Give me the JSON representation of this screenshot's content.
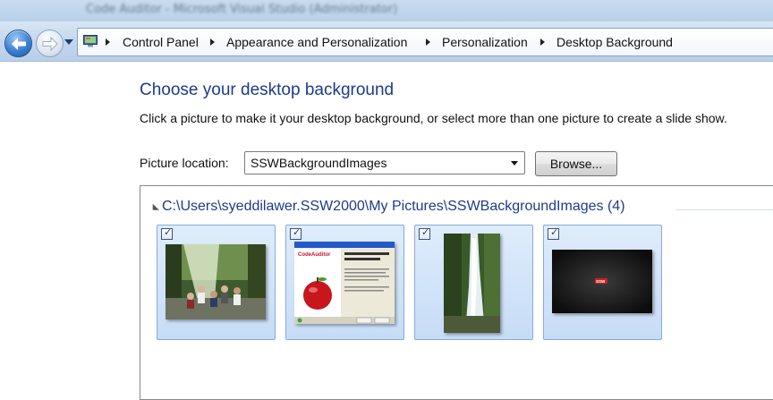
{
  "window": {
    "title": "Code Auditor - Microsoft Visual Studio (Administrator)"
  },
  "nav": {
    "breadcrumbs": [
      "Control Panel",
      "Appearance and Personalization",
      "Personalization",
      "Desktop Background"
    ]
  },
  "content": {
    "title": "Choose your desktop background",
    "description": "Click a picture to make it your desktop background, or select more than one picture to create a slide show.",
    "location_label": "Picture location:",
    "location_value": "SSWBackgroundImages",
    "browse_label": "Browse..."
  },
  "group": {
    "header": "C:\\Users\\syeddilawer.SSW2000\\My Pictures\\SSWBackgroundImages (4)"
  },
  "thumbnails": [
    {
      "name": "forest-group-photo",
      "checked": true
    },
    {
      "name": "code-auditor-welcome-screen",
      "checked": true,
      "window_title": "Welcome to SSW Code Auditor",
      "logo_text": "CodeAuditor"
    },
    {
      "name": "waterfall",
      "checked": true
    },
    {
      "name": "ssw-dark-wallpaper",
      "checked": true,
      "logo_text": "SSW"
    }
  ],
  "icons": {
    "back": "back-arrow-icon",
    "forward": "forward-arrow-icon",
    "recent": "dropdown-triangle-icon",
    "address": "control-panel-icon",
    "checkbox": "checkmark-icon"
  },
  "colors": {
    "accent_title": "#1e3a8c",
    "selection_fill": "#c6dcf6",
    "selection_border": "#84acdd"
  }
}
